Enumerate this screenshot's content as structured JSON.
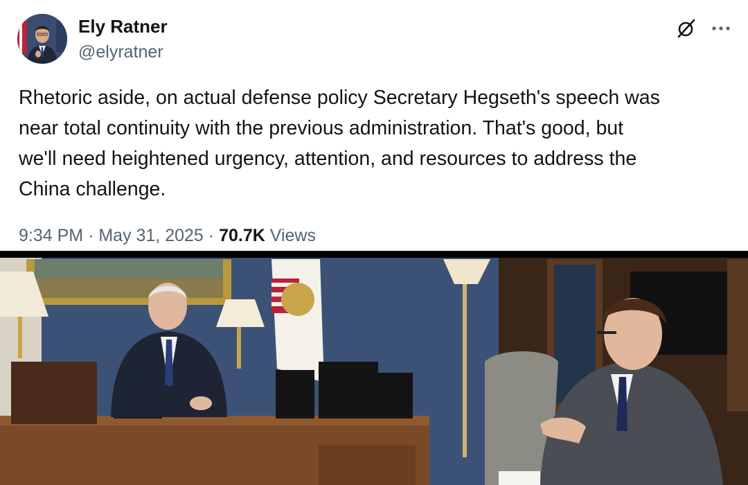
{
  "author": {
    "name": "Ely Ratner",
    "handle": "@elyratner"
  },
  "icons": {
    "grok": "grok-icon",
    "more": "more-icon"
  },
  "tweet": {
    "text_lines": [
      "Rhetoric aside, on actual defense policy Secretary Hegseth's speech was",
      "near total continuity with the previous administration. That's good, but",
      "we'll need heightened urgency, attention, and resources to address the",
      "China challenge."
    ],
    "time": "9:34 PM",
    "separator": "·",
    "date": "May 31, 2025",
    "views_count": "70.7K",
    "views_label": "Views"
  },
  "colors": {
    "text": "#0f1419",
    "secondary_text": "#536471",
    "wall": "#3c5478",
    "desk": "#7a4a26"
  }
}
